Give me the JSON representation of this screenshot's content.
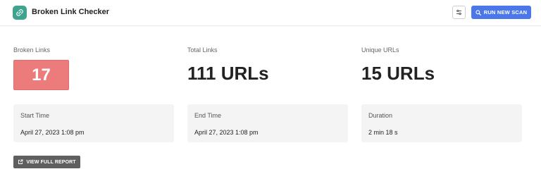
{
  "header": {
    "title": "Broken Link Checker",
    "app_icon": "broken-link-icon",
    "settings_icon": "settings-sliders-icon",
    "scan_button_label": "RUN NEW SCAN",
    "scan_button_icon": "search-icon"
  },
  "stats": {
    "broken": {
      "label": "Broken Links",
      "value": "17"
    },
    "total": {
      "label": "Total Links",
      "value": "111 URLs"
    },
    "unique": {
      "label": "Unique URLs",
      "value": "15 URLs"
    }
  },
  "cards": {
    "start": {
      "label": "Start Time",
      "value": "April 27, 2023 1:08 pm"
    },
    "end": {
      "label": "End Time",
      "value": "April 27, 2023 1:08 pm"
    },
    "duration": {
      "label": "Duration",
      "value": "2 min 18 s"
    }
  },
  "report_button": {
    "label": "VIEW FULL REPORT",
    "icon": "external-link-icon"
  },
  "colors": {
    "accent": "#4b77ea",
    "brand": "#3fa38f",
    "broken_badge": "#ec7c7c",
    "report_button": "#5f5f5f"
  }
}
